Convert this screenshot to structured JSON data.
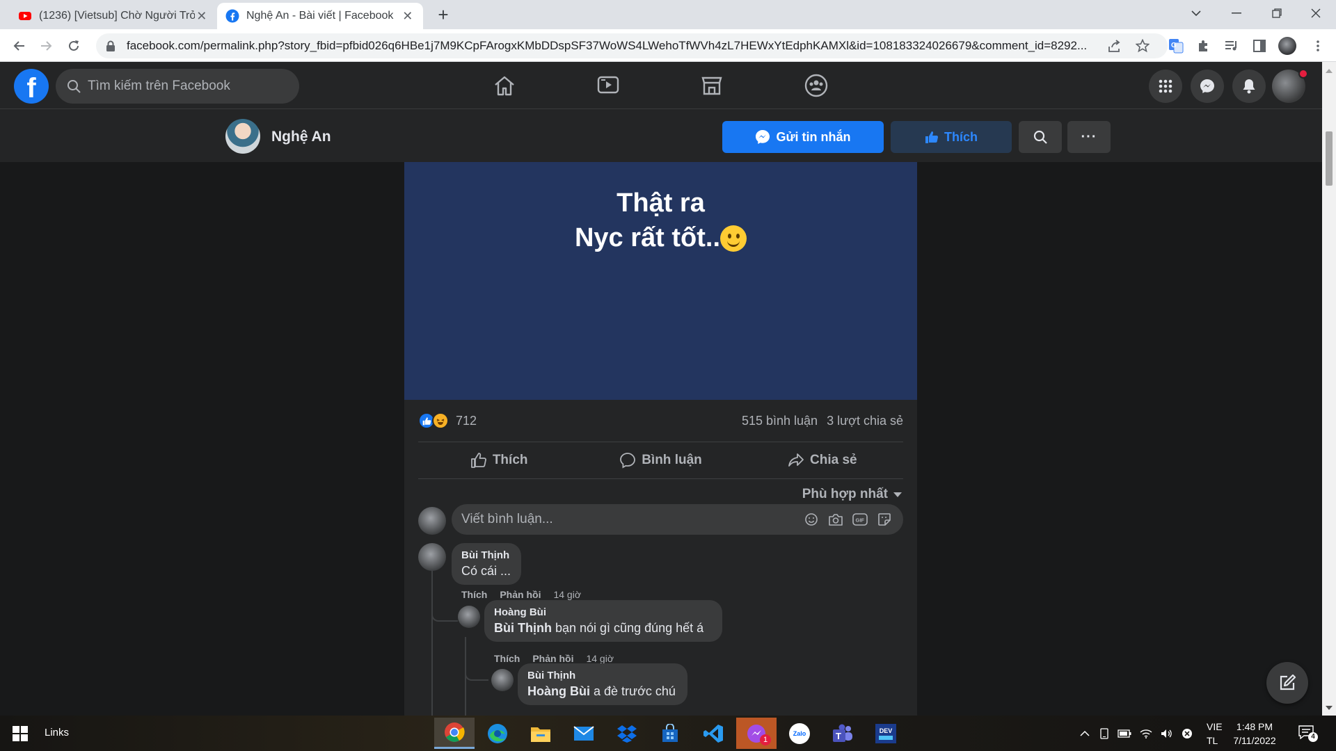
{
  "browser": {
    "tabs": [
      {
        "title": "(1236) [Vietsub] Chờ Người Trở Lại",
        "favicon": "youtube-icon"
      },
      {
        "title": "Nghệ An - Bài viết | Facebook",
        "favicon": "facebook-icon",
        "active": true
      }
    ],
    "url": "facebook.com/permalink.php?story_fbid=pfbid026q6HBe1j7M9KCpFArogxKMbDDspSF37WoWS4LWehoTfWVh4zL7HEWxYtEdphKAMXl&id=108183324026679&comment_id=8292..."
  },
  "facebook": {
    "logo_letter": "f",
    "search_placeholder": "Tìm kiếm trên Facebook",
    "nav_icons": [
      "home-icon",
      "watch-icon",
      "marketplace-icon",
      "groups-icon"
    ],
    "right_icons": [
      "menu-grid-icon",
      "messenger-icon",
      "notifications-icon"
    ]
  },
  "page": {
    "name": "Nghệ An",
    "message_button": "Gửi tin nhắn",
    "like_button": "Thích",
    "more_label": "···"
  },
  "post": {
    "image_text_line1": "Thật ra",
    "image_text_line2": "Nyc rất tốt..",
    "reaction_count": "712",
    "comments_count": "515 bình luận",
    "shares_count": "3 lượt chia sẻ",
    "actions": {
      "like": "Thích",
      "comment": "Bình luận",
      "share": "Chia sẻ"
    },
    "sort_label": "Phù hợp nhất",
    "composer_placeholder": "Viết bình luận..."
  },
  "comments": [
    {
      "author": "Bùi Thịnh",
      "text": "Có cái ...",
      "like": "Thích",
      "reply": "Phản hồi",
      "time": "14 giờ"
    },
    {
      "author": "Hoàng Bùi",
      "mention": "Bùi Thịnh",
      "text": " bạn nói gì cũng đúng hết á",
      "like": "Thích",
      "reply": "Phản hồi",
      "time": "14 giờ"
    },
    {
      "author": "Bùi Thịnh",
      "mention": "Hoàng Bùi",
      "text": " a đè trước chú"
    }
  ],
  "taskbar": {
    "links_label": "Links",
    "apps": [
      "chrome-icon",
      "edge-icon",
      "file-explorer-icon",
      "mail-icon",
      "dropbox-icon",
      "store-icon",
      "vscode-icon",
      "messenger-app-icon",
      "zalo-icon",
      "teams-icon",
      "devc-icon"
    ],
    "messenger_badge": "1",
    "zalo_label": "Zalo",
    "dev_label": "DEV",
    "lang_line1": "VIE",
    "lang_line2": "TL",
    "time": "1:48 PM",
    "date": "7/11/2022",
    "notification_count": "4"
  },
  "colors": {
    "fb_blue": "#1877f2",
    "fb_dark_bg": "#18191a",
    "fb_surface": "#242526",
    "post_image_bg": "#23355f"
  }
}
